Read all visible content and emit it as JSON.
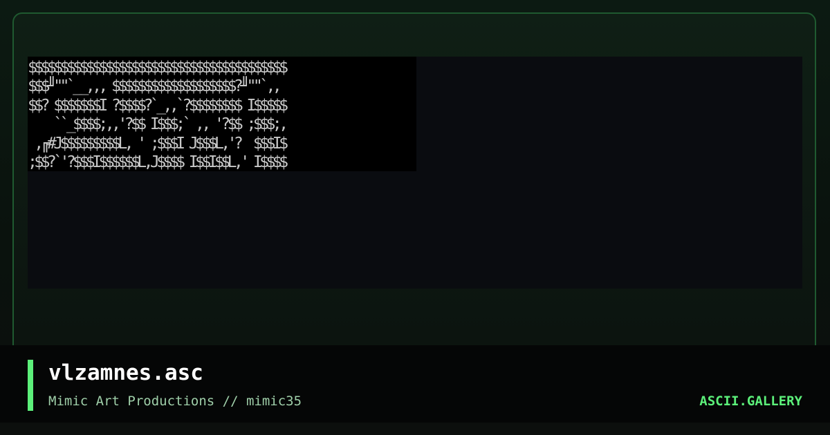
{
  "artwork": {
    "lines": [
      "$$$$$$$$$$$$$$$$$$$$$$$$$$$$$$$$$$$$$$$$",
      "$$$╜\"\"`__,,, $$$$$$$$$$$$$$$$$$$?╜\"\"`,,",
      "$$? $$$$$$$I ?$$$$?`_,,`?$$$$$$$$ I$$$$$",
      "    ``_$$$$;,,'?$$ I$$$;` ,, '?$$ ;$$$;,",
      " ,╓#J$$$$$$$$$L, ' ;$$$I J$$$L,'?  $$$I$",
      ";$$?`'?$$$I$$$$$$L,J$$$$ I$$I$$L,' I$$$$"
    ]
  },
  "footer": {
    "title": "vlzamnes.asc",
    "subtitle": "Mimic Art Productions // mimic35",
    "brand": "ASCII.GALLERY"
  },
  "colors": {
    "accent": "#5cf07a",
    "frame_border": "#1f5a30",
    "ascii_text": "#c8c8c8",
    "subtitle_text": "#9fcfa9"
  }
}
